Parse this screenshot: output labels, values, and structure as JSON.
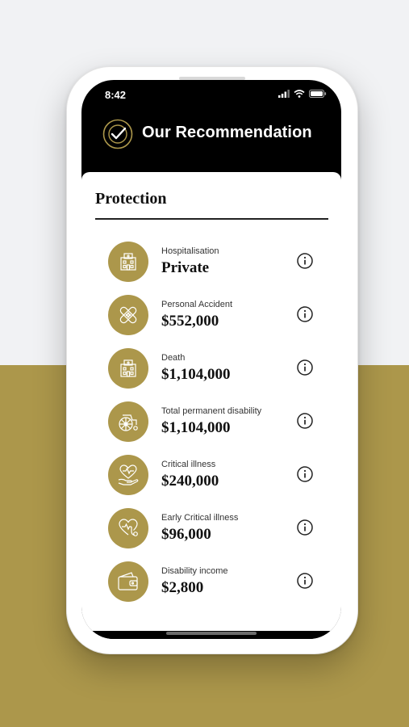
{
  "status_bar": {
    "time": "8:42"
  },
  "header": {
    "title": "Our Recommendation",
    "logo_icon": "check-circle-icon"
  },
  "section": {
    "title": "Protection"
  },
  "colors": {
    "gold": "#ac974b",
    "black": "#000000",
    "background_top": "#f1f2f4"
  },
  "items": [
    {
      "label": "Hospitalisation",
      "value": "Private",
      "icon": "hospital-icon"
    },
    {
      "label": "Personal Accident",
      "value": "$552,000",
      "icon": "bandage-icon"
    },
    {
      "label": "Death",
      "value": "$1,104,000",
      "icon": "hospital-icon"
    },
    {
      "label": "Total permanent disability",
      "value": "$1,104,000",
      "icon": "wheelchair-icon"
    },
    {
      "label": "Critical illness",
      "value": "$240,000",
      "icon": "heart-hand-icon"
    },
    {
      "label": "Early Critical illness",
      "value": "$96,000",
      "icon": "stethoscope-icon"
    },
    {
      "label": "Disability income",
      "value": "$2,800",
      "icon": "wallet-icon"
    }
  ]
}
